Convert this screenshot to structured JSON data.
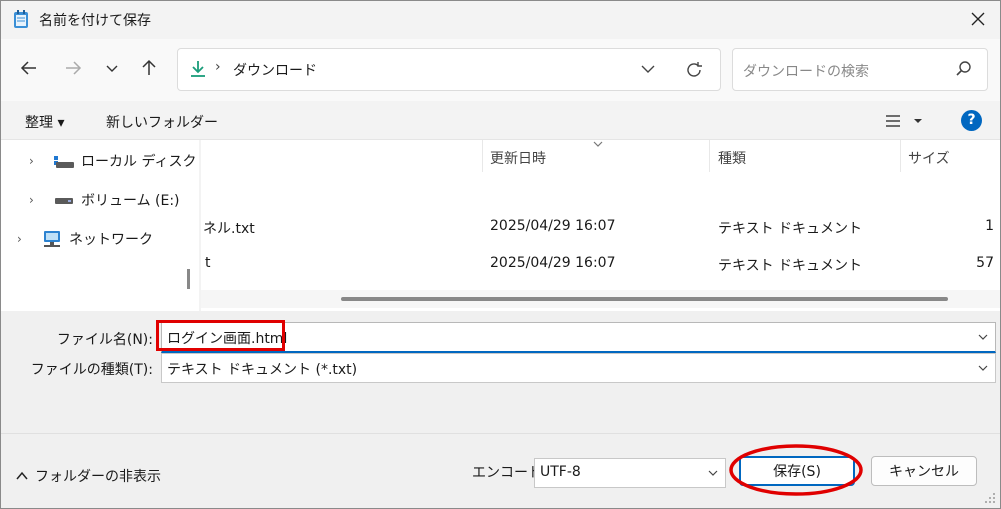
{
  "window": {
    "title": "名前を付けて保存",
    "accent": "#0067c0",
    "annotation_color": "#e00000"
  },
  "nav": {
    "path_sep": "›",
    "path": "ダウンロード",
    "search_placeholder": "ダウンロードの検索"
  },
  "commands": {
    "organize": "整理 ▾",
    "new_folder": "新しいフォルダー"
  },
  "tree": [
    {
      "label": "ローカル ディスク"
    },
    {
      "label": "ボリューム (E:)"
    },
    {
      "label": "ネットワーク"
    }
  ],
  "columns": {
    "modified": "更新日時",
    "type": "種類",
    "size": "サイズ"
  },
  "files": [
    {
      "name": "ネル.txt",
      "modified": "2025/04/29 16:07",
      "type": "テキスト ドキュメント",
      "size": "1"
    },
    {
      "name": "t",
      "modified": "2025/04/29 16:07",
      "type": "テキスト ドキュメント",
      "size": "57"
    }
  ],
  "form": {
    "filename_label": "ファイル名(N):",
    "filename_value": "ログイン画面.html",
    "filetype_label": "ファイルの種類(T):",
    "filetype_value": "テキスト ドキュメント (*.txt)"
  },
  "footer": {
    "hide_folders": "フォルダーの非表示",
    "encoding_label": "エンコード:",
    "encoding_value": "UTF-8",
    "save": "保存(S)",
    "cancel": "キャンセル"
  }
}
